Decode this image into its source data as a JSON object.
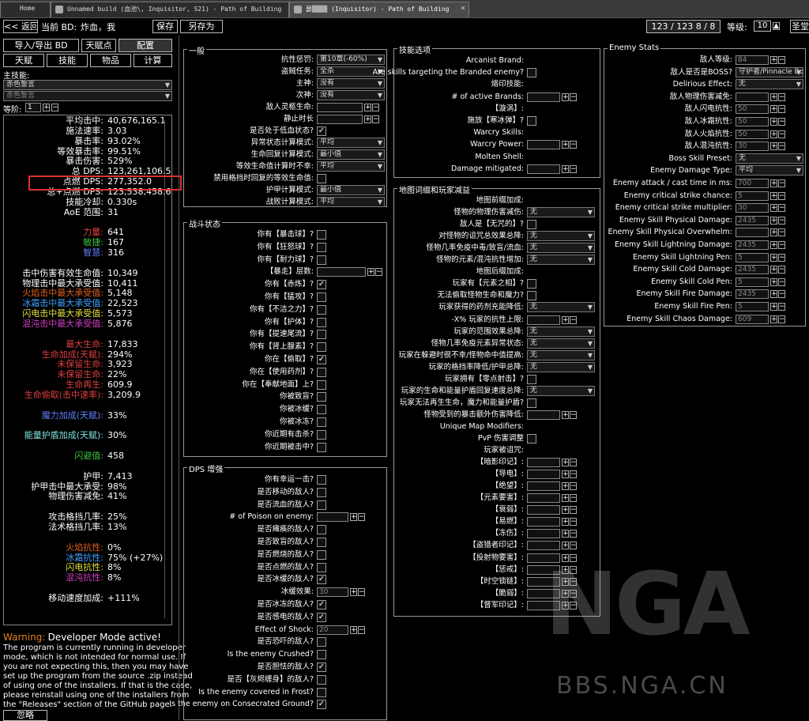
{
  "tabs": [
    {
      "label": "Home"
    },
    {
      "label": "Unnamed build (血池\\, Inquisitor, S21) - Path of Building"
    },
    {
      "label": "瑟▒▒▒▒ (Inquisitor) - Path of Building"
    }
  ],
  "topbar": {
    "back": "<< 返回",
    "current_bd_label": "当前 BD:",
    "current_bd": "炸血，我",
    "save": "保存",
    "save_as": "另存为",
    "points": "123 / 123   8 / 8",
    "level_label": "等级:",
    "level": "10",
    "extra": "圣堂"
  },
  "left": {
    "import_export": "导入/导出 BD",
    "tree_points": "天赋点",
    "config": "配置",
    "talent": "天赋",
    "skills": "技能",
    "items": "物品",
    "calc": "计算",
    "main_skill_label": "主技能:",
    "main_skill": "赤色誓言",
    "sub_skill": "赤色誓言",
    "level_label": "等阶:",
    "level": "1"
  },
  "stats": [
    {
      "k": "平均击中:",
      "v": "40,676,165.1",
      "kc": "#fff"
    },
    {
      "k": "施法速率:",
      "v": "3.03",
      "kc": "#fff"
    },
    {
      "k": "暴击率:",
      "v": "93.02%",
      "kc": "#fff"
    },
    {
      "k": "等效暴击率:",
      "v": "99.51%",
      "kc": "#fff"
    },
    {
      "k": "暴击伤害:",
      "v": "529%",
      "kc": "#fff"
    },
    {
      "k": "总 DPS:",
      "v": "123,261,106.5",
      "kc": "#fff"
    },
    {
      "k": "点燃 DPS:",
      "v": "277,352.0",
      "kc": "#fff"
    },
    {
      "k": "总+点燃 DPS:",
      "v": "123,538,458.6",
      "kc": "#fff"
    },
    {
      "k": "技能冷却:",
      "v": "0.330s",
      "kc": "#fff"
    },
    {
      "k": "AoE 范围:",
      "v": "31",
      "kc": "#fff"
    },
    {
      "k": "",
      "v": "",
      "kc": "#fff"
    },
    {
      "k": "力量:",
      "v": "641",
      "kc": "#e04040"
    },
    {
      "k": "敏捷:",
      "v": "167",
      "kc": "#40c040"
    },
    {
      "k": "智慧:",
      "v": "316",
      "kc": "#6080ff"
    },
    {
      "k": "",
      "v": "",
      "kc": "#fff"
    },
    {
      "k": "击中伤害有效生命值:",
      "v": "10,349",
      "kc": "#fff"
    },
    {
      "k": "物理击中最大承受值:",
      "v": "10,411",
      "kc": "#fff"
    },
    {
      "k": "火焰击中最大承受值:",
      "v": "5,148",
      "kc": "#e06020"
    },
    {
      "k": "冰霜击中最大承受值:",
      "v": "22,523",
      "kc": "#40a0ff"
    },
    {
      "k": "闪电击中最大承受值:",
      "v": "5,573",
      "kc": "#e0e040"
    },
    {
      "k": "混沌击中最大承受值:",
      "v": "5,876",
      "kc": "#d040c0"
    },
    {
      "k": "",
      "v": "",
      "kc": "#fff"
    },
    {
      "k": "最大生命:",
      "v": "17,833",
      "kc": "#e04040"
    },
    {
      "k": "生命加成(天赋):",
      "v": "294%",
      "kc": "#e04040"
    },
    {
      "k": "未保留生命:",
      "v": "3,923",
      "kc": "#e04040"
    },
    {
      "k": "未保留生命:",
      "v": "22%",
      "kc": "#e04040"
    },
    {
      "k": "生命再生:",
      "v": "609.9",
      "kc": "#e04040"
    },
    {
      "k": "生命偷取(击中速率):",
      "v": "3,209.9",
      "kc": "#e04040"
    },
    {
      "k": "",
      "v": "",
      "kc": "#fff"
    },
    {
      "k": "魔力加成(天赋):",
      "v": "33%",
      "kc": "#6080ff"
    },
    {
      "k": "",
      "v": "",
      "kc": "#fff"
    },
    {
      "k": "能量护盾加成(天赋):",
      "v": "30%",
      "kc": "#80e0e0"
    },
    {
      "k": "",
      "v": "",
      "kc": "#fff"
    },
    {
      "k": "闪避值:",
      "v": "458",
      "kc": "#40c040"
    },
    {
      "k": "",
      "v": "",
      "kc": "#fff"
    },
    {
      "k": "护甲:",
      "v": "7,413",
      "kc": "#fff"
    },
    {
      "k": "护甲击中最大承受:",
      "v": "98%",
      "kc": "#fff"
    },
    {
      "k": "物理伤害减免:",
      "v": "41%",
      "kc": "#fff"
    },
    {
      "k": "",
      "v": "",
      "kc": "#fff"
    },
    {
      "k": "攻击格挡几率:",
      "v": "25%",
      "kc": "#fff"
    },
    {
      "k": "法术格挡几率:",
      "v": "13%",
      "kc": "#fff"
    },
    {
      "k": "",
      "v": "",
      "kc": "#fff"
    },
    {
      "k": "火焰抗性:",
      "v": "0%",
      "kc": "#e06020"
    },
    {
      "k": "冰霜抗性:",
      "v": "75% (+27%)",
      "kc": "#40a0ff"
    },
    {
      "k": "闪电抗性:",
      "v": "8%",
      "kc": "#e0e040"
    },
    {
      "k": "混沌抗性:",
      "v": "8%",
      "kc": "#d040c0"
    },
    {
      "k": "",
      "v": "",
      "kc": "#fff"
    },
    {
      "k": "移动速度加成:",
      "v": "+111%",
      "kc": "#fff"
    }
  ],
  "warning": {
    "title": "Warning:",
    "title2": "Developer Mode active!",
    "body": "The program is currently running in developer mode, which is not intended for normal use. If you are not expecting this, then you may have set up the program from the source .zip instead of using one of the installers. If that is the case, please reinstall using one of the installers from the \"Releases\" section of the GitHub page.",
    "ignore": "忽略"
  },
  "general": {
    "title": "一般",
    "rows": [
      {
        "label": "抗性惩罚:",
        "type": "dd",
        "value": "第10章(-60%)"
      },
      {
        "label": "盗贼任务:",
        "type": "dd",
        "value": "全杀"
      },
      {
        "label": "主神:",
        "type": "dd",
        "value": "没有"
      },
      {
        "label": "次神:",
        "type": "dd",
        "value": "没有"
      },
      {
        "label": "敌人灵柩生命:",
        "type": "inp",
        "value": ""
      },
      {
        "label": "静止时长",
        "type": "inp",
        "value": ""
      },
      {
        "label": "是否处于低血状态?",
        "type": "cb",
        "value": "✓"
      },
      {
        "label": "异常状态计算模式:",
        "type": "dd",
        "value": "平均"
      },
      {
        "label": "生命回复计算模式:",
        "type": "dd",
        "value": "最小值"
      },
      {
        "label": "等效生命值计算时不幸:",
        "type": "dd",
        "value": "平均"
      },
      {
        "label": "禁用格挡时回复的等效生命值:",
        "type": "cb",
        "value": ""
      },
      {
        "label": "护甲计算模式:",
        "type": "dd",
        "value": "最小值"
      },
      {
        "label": "战败计算模式:",
        "type": "dd",
        "value": "平均"
      }
    ]
  },
  "combat": {
    "title": "战斗状态",
    "rows": [
      {
        "label": "你有【暴击球】?",
        "type": "cb",
        "value": ""
      },
      {
        "label": "你有【狂怒球】?",
        "type": "cb",
        "value": ""
      },
      {
        "label": "你有【耐力球】?",
        "type": "cb",
        "value": ""
      },
      {
        "label": "【暴走】层数:",
        "type": "inp",
        "value": ""
      },
      {
        "label": "你有【赤炼】?",
        "type": "cb",
        "value": "✓"
      },
      {
        "label": "你有【猛攻】?",
        "type": "cb",
        "value": ""
      },
      {
        "label": "你有【不洁之力】?",
        "type": "cb",
        "value": ""
      },
      {
        "label": "你有【护体】?",
        "type": "cb",
        "value": ""
      },
      {
        "label": "你有【提速尾流】?",
        "type": "cb",
        "value": ""
      },
      {
        "label": "你有【肾上腺素】?",
        "type": "cb",
        "value": ""
      },
      {
        "label": "你在【偷取】?",
        "type": "cb",
        "value": "✓"
      },
      {
        "label": "你在【使用药剂】?",
        "type": "cb",
        "value": ""
      },
      {
        "label": "你在【奉献地面】上?",
        "type": "cb",
        "value": ""
      },
      {
        "label": "你被致盲?",
        "type": "cb",
        "value": ""
      },
      {
        "label": "你被冰缓?",
        "type": "cb",
        "value": ""
      },
      {
        "label": "你被冰冻?",
        "type": "cb",
        "value": ""
      },
      {
        "label": "你近期有击杀?",
        "type": "cb",
        "value": ""
      },
      {
        "label": "你近期被击中?",
        "type": "cb",
        "value": ""
      }
    ]
  },
  "dps": {
    "title": "DPS 增强",
    "rows": [
      {
        "label": "你有幸运一击?",
        "type": "cb",
        "value": ""
      },
      {
        "label": "是否移动的敌人?",
        "type": "cb",
        "value": ""
      },
      {
        "label": "是否流血的敌人?",
        "type": "cb",
        "value": ""
      },
      {
        "label": "# of Poison on enemy:",
        "type": "inp",
        "value": ""
      },
      {
        "label": "是否瘫痪的敌人?",
        "type": "cb",
        "value": ""
      },
      {
        "label": "是否致盲的敌人?",
        "type": "cb",
        "value": ""
      },
      {
        "label": "是否燃烧的敌人?",
        "type": "cb",
        "value": ""
      },
      {
        "label": "是否点燃的敌人?",
        "type": "cb",
        "value": ""
      },
      {
        "label": "是否冰缓的敌人?",
        "type": "cb",
        "value": "✓"
      },
      {
        "label": "冰缓效果:",
        "type": "inp",
        "value": "30"
      },
      {
        "label": "是否冰冻的敌人?",
        "type": "cb",
        "value": "✓"
      },
      {
        "label": "是否感电的敌人?",
        "type": "cb",
        "value": "✓"
      },
      {
        "label": "Effect of Shock:",
        "type": "inp",
        "value": "20"
      },
      {
        "label": "是否恐吓的敌人?",
        "type": "cb",
        "value": ""
      },
      {
        "label": "Is the enemy Crushed?",
        "type": "cb",
        "value": ""
      },
      {
        "label": "是否胆怯的敌人?",
        "type": "cb",
        "value": "✓"
      },
      {
        "label": "是否【灰烬缠身】的敌人?",
        "type": "cb",
        "value": ""
      },
      {
        "label": "Is the enemy covered in Frost?",
        "type": "cb",
        "value": ""
      },
      {
        "label": "Is the enemy on Consecrated Ground?",
        "type": "cb",
        "value": "✓"
      }
    ]
  },
  "skillopt": {
    "title": "技能选项",
    "rows": [
      {
        "label": "Arcanist Brand:",
        "type": "none",
        "value": ""
      },
      {
        "label": "Are skills targeting the Branded enemy?",
        "type": "cb",
        "value": ""
      },
      {
        "label": "烙印技能:",
        "type": "none",
        "value": ""
      },
      {
        "label": "# of active Brands:",
        "type": "inp",
        "value": ""
      },
      {
        "label": "【漩涡】:",
        "type": "none",
        "value": ""
      },
      {
        "label": "施放【寒冰弹】?",
        "type": "cb",
        "value": ""
      },
      {
        "label": "Warcry Skills:",
        "type": "none",
        "value": ""
      },
      {
        "label": "Warcry Power:",
        "type": "inp",
        "value": ""
      },
      {
        "label": "Molten Shell:",
        "type": "none",
        "value": ""
      },
      {
        "label": "Damage mitigated:",
        "type": "inp",
        "value": ""
      }
    ]
  },
  "map": {
    "title": "地图词缀和玩家减益",
    "rows": [
      {
        "label": "地图前缀加成:",
        "type": "none",
        "value": ""
      },
      {
        "label": "怪物的物理伤害减伤:",
        "type": "dd",
        "value": "无"
      },
      {
        "label": "敌人是【无咒的】?",
        "type": "cb",
        "value": ""
      },
      {
        "label": "对怪物的诅咒总效果总降:",
        "type": "dd",
        "value": "无"
      },
      {
        "label": "怪物几率免疫中毒/致盲/流血:",
        "type": "dd",
        "value": "无"
      },
      {
        "label": "怪物的元素/混沌抗性增加:",
        "type": "dd",
        "value": "无"
      },
      {
        "label": "地图后缀加成:",
        "type": "none",
        "value": ""
      },
      {
        "label": "玩家有【元素之相】?",
        "type": "cb",
        "value": ""
      },
      {
        "label": "无法偷取怪物生命和魔力?",
        "type": "cb",
        "value": ""
      },
      {
        "label": "玩家获得的药剂充能降低:",
        "type": "dd",
        "value": "无"
      },
      {
        "label": "-X% 玩家的抗性上限:",
        "type": "inp",
        "value": ""
      },
      {
        "label": "玩家的范围效果总降:",
        "type": "dd",
        "value": "无"
      },
      {
        "label": "怪物几率免疫元素异常状态:",
        "type": "dd",
        "value": "无"
      },
      {
        "label": "玩家在躲避时很不幸/怪物命中值提高:",
        "type": "dd",
        "value": "无"
      },
      {
        "label": "玩家的格挡率降低/护甲总降:",
        "type": "dd",
        "value": "无"
      },
      {
        "label": "玩家拥有【零点射击】?",
        "type": "cb",
        "value": ""
      },
      {
        "label": "玩家的生命和能量护盾回复速度总降:",
        "type": "dd",
        "value": "无"
      },
      {
        "label": "玩家无法再生生命，魔力和能量护盾?",
        "type": "cb",
        "value": ""
      },
      {
        "label": "怪物受到的暴击额外伤害降低:",
        "type": "inp",
        "value": ""
      },
      {
        "label": "Unique Map Modifiers:",
        "type": "none",
        "value": ""
      },
      {
        "label": "PvP 伤害调整",
        "type": "cb",
        "value": ""
      },
      {
        "label": "玩家被诅咒:",
        "type": "none",
        "value": ""
      },
      {
        "label": "【暗影印记】:",
        "type": "inp",
        "value": ""
      },
      {
        "label": "【导电】:",
        "type": "inp",
        "value": ""
      },
      {
        "label": "【绝望】:",
        "type": "inp",
        "value": ""
      },
      {
        "label": "【元素要害】:",
        "type": "inp",
        "value": ""
      },
      {
        "label": "【衰弱】:",
        "type": "inp",
        "value": ""
      },
      {
        "label": "【易燃】:",
        "type": "inp",
        "value": ""
      },
      {
        "label": "【冻伤】:",
        "type": "inp",
        "value": ""
      },
      {
        "label": "【盗猎者印记】:",
        "type": "inp",
        "value": ""
      },
      {
        "label": "【投射物要害】:",
        "type": "inp",
        "value": ""
      },
      {
        "label": "【惩戒】:",
        "type": "inp",
        "value": ""
      },
      {
        "label": "【时空锁链】:",
        "type": "inp",
        "value": ""
      },
      {
        "label": "【脆弱】:",
        "type": "inp",
        "value": ""
      },
      {
        "label": "【督军印记】:",
        "type": "inp",
        "value": ""
      }
    ]
  },
  "enemy": {
    "title": "Enemy Stats",
    "rows": [
      {
        "label": "敌人等级:",
        "type": "inp",
        "value": "84"
      },
      {
        "label": "敌人是否是BOSS?",
        "type": "dd",
        "value": "守护者/Pinnacle Bo"
      },
      {
        "label": "Delirious Effect:",
        "type": "dd",
        "value": "无"
      },
      {
        "label": "敌人物理伤害减免:",
        "type": "inp",
        "value": ""
      },
      {
        "label": "敌人闪电抗性:",
        "type": "inp",
        "value": "50"
      },
      {
        "label": "敌人冰霜抗性:",
        "type": "inp",
        "value": "50"
      },
      {
        "label": "敌人火焰抗性:",
        "type": "inp",
        "value": "50"
      },
      {
        "label": "敌人混沌抗性:",
        "type": "inp",
        "value": "30"
      },
      {
        "label": "Boss Skill Preset:",
        "type": "dd",
        "value": "无"
      },
      {
        "label": "Enemy Damage Type:",
        "type": "dd",
        "value": "平均"
      },
      {
        "label": "Enemy attack / cast time in ms:",
        "type": "inp",
        "value": "700"
      },
      {
        "label": "Enemy critical strike chance:",
        "type": "inp",
        "value": "5"
      },
      {
        "label": "Enemy critical strike multiplier:",
        "type": "inp",
        "value": "30"
      },
      {
        "label": "Enemy Skill Physical Damage:",
        "type": "inp",
        "value": "2435"
      },
      {
        "label": "Enemy Skill Physical Overwhelm:",
        "type": "inp",
        "value": ""
      },
      {
        "label": "Enemy Skill Lightning Damage:",
        "type": "inp",
        "value": "2435"
      },
      {
        "label": "Enemy Skill Lightning Pen:",
        "type": "inp",
        "value": "5"
      },
      {
        "label": "Enemy Skill Cold Damage:",
        "type": "inp",
        "value": "2435"
      },
      {
        "label": "Enemy Skill Cold Pen:",
        "type": "inp",
        "value": "5"
      },
      {
        "label": "Enemy Skill Fire Damage:",
        "type": "inp",
        "value": "2435"
      },
      {
        "label": "Enemy Skill Fire Pen:",
        "type": "inp",
        "value": "5"
      },
      {
        "label": "Enemy Skill Chaos Damage:",
        "type": "inp",
        "value": "609"
      }
    ]
  },
  "watermark": {
    "logo": "NGA",
    "url": "BBS.NGA.CN"
  },
  "colors": {
    "highlight": "#e03030"
  }
}
